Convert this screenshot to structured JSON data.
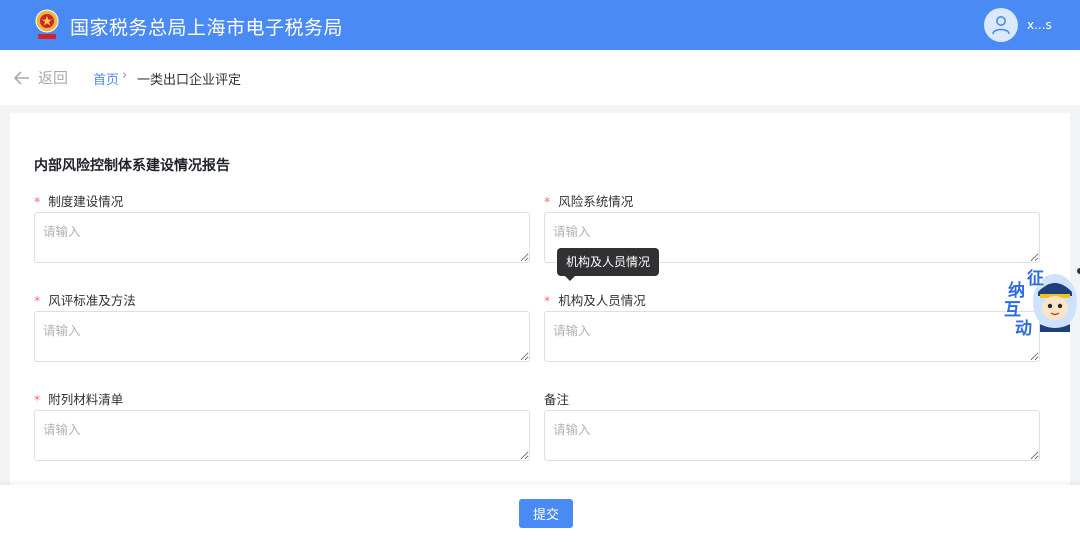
{
  "header": {
    "title": "国家税务总局上海市电子税务局",
    "user_name": "x...s",
    "brand_color": "#4a8af4",
    "logo_icon": "tax-emblem-icon",
    "avatar_icon": "user-avatar-icon"
  },
  "nav": {
    "back_label": "返回",
    "back_icon": "arrow-left-icon",
    "breadcrumb": {
      "home": "首页",
      "separator": "›",
      "current": "一类出口企业评定"
    }
  },
  "form": {
    "section_title": "内部风险控制体系建设情况报告",
    "required_mark": "*",
    "fields": [
      {
        "label": "制度建设情况",
        "required": true,
        "placeholder": "请输入",
        "value": ""
      },
      {
        "label": "风险系统情况",
        "required": true,
        "placeholder": "请输入",
        "value": ""
      },
      {
        "label": "风评标准及方法",
        "required": true,
        "placeholder": "请输入",
        "value": ""
      },
      {
        "label": "机构及人员情况",
        "required": true,
        "placeholder": "请输入",
        "value": ""
      },
      {
        "label": "附列材料清单",
        "required": true,
        "placeholder": "请输入",
        "value": ""
      },
      {
        "label": "备注",
        "required": false,
        "placeholder": "请输入",
        "value": ""
      }
    ],
    "tooltip": "机构及人员情况",
    "required_color": "#f56c6c"
  },
  "footer": {
    "submit_label": "提交"
  },
  "float_widget": {
    "chars": [
      "征",
      "纳",
      "互",
      "动"
    ],
    "icon": "mascot-icon"
  }
}
